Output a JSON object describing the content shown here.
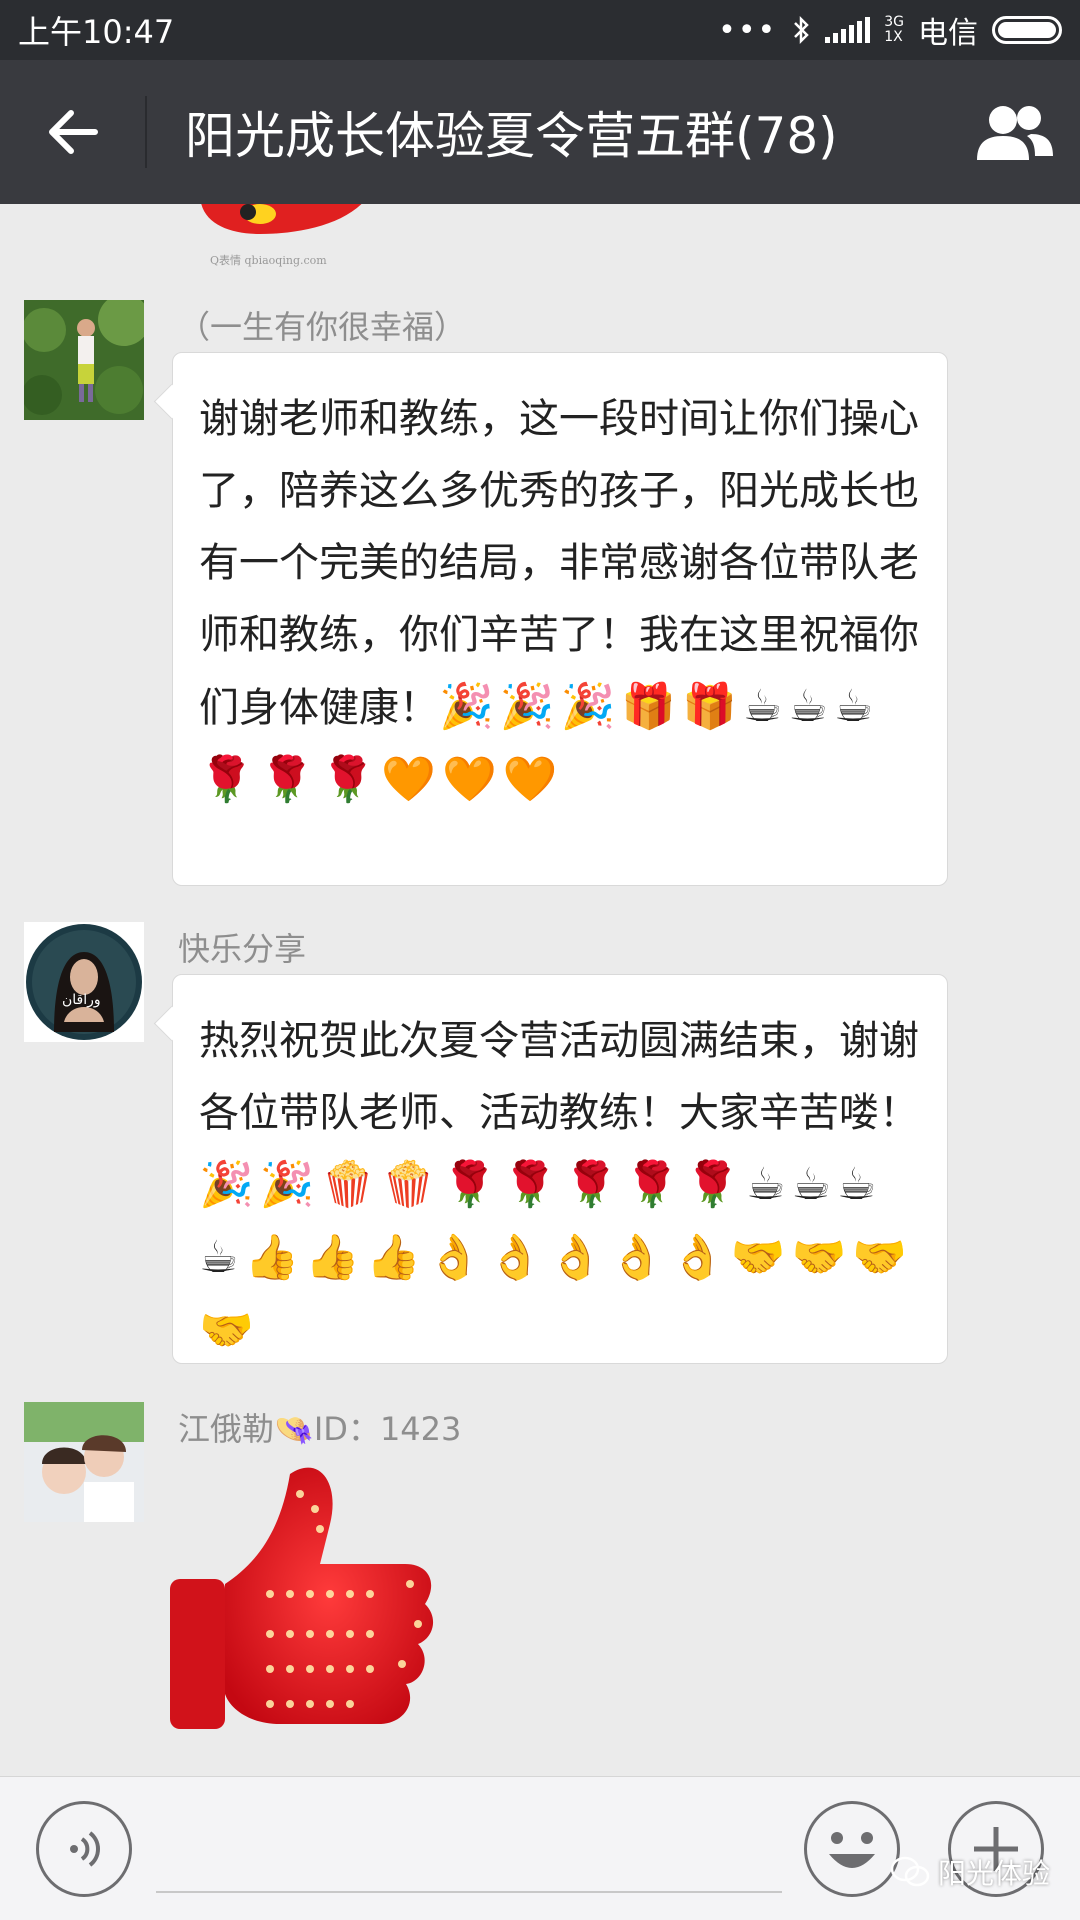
{
  "status_bar": {
    "time": "上午10:47",
    "network_top": "3G",
    "network_bottom": "1X",
    "carrier": "电信",
    "icons": [
      "more-dots-icon",
      "bluetooth-icon",
      "signal-icon",
      "battery-icon"
    ]
  },
  "header": {
    "title": "阳光成长体验夏令营五群(78)",
    "back_icon": "arrow-left-icon",
    "members_icon": "group-members-icon"
  },
  "partial_sticker_caption": "Q表情 qbiaoqing.com",
  "messages": [
    {
      "sender": "（一生有你很幸福）",
      "text": "谢谢老师和教练，这一段时间让你们操心了，陪养这么多优秀的孩子，阳光成长也有一个完美的结局，非常感谢各位带队老师和教练，你们辛苦了！我在这里祝福你们身体健康！",
      "emojis": "🎉🎉🎉🎁🎁☕☕☕🌹🌹🌹🧡🧡🧡"
    },
    {
      "sender": "快乐分享",
      "avatar_text": "وراقان",
      "text": "热烈祝贺此次夏令营活动圆满结束，谢谢各位带队老师、活动教练！大家辛苦喽！",
      "emojis": "🎉🎉🍿🍿🌹🌹🌹🌹🌹☕☕☕☕👍👍👍👌👌👌👌👌🤝🤝🤝🤝"
    },
    {
      "sender_prefix": "江俄勒",
      "sender_suffix": "ID：1423",
      "sticker": "thumbs-up-sticker"
    }
  ],
  "input_bar": {
    "voice_icon": "voice-icon",
    "emoji_icon": "smiley-icon",
    "plus_icon": "plus-icon"
  },
  "watermark": "阳光体验",
  "colors": {
    "status_bar": "#2b2d31",
    "title_bar": "#393a3f",
    "chat_background": "#ebebeb",
    "bubble": "#ffffff",
    "sender_name": "#8e8e8e",
    "sticker_red": "#e8141a"
  }
}
